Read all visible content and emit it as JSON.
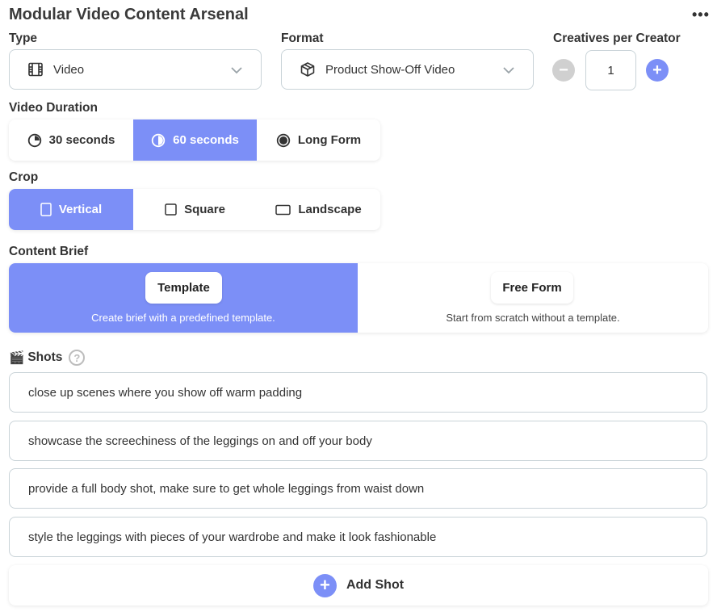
{
  "page": {
    "title": "Modular Video Content Arsenal",
    "more_label": "•••"
  },
  "type": {
    "label": "Type",
    "value": "Video",
    "icon": "film-icon"
  },
  "format": {
    "label": "Format",
    "value": "Product Show-Off Video",
    "icon": "cube-icon"
  },
  "creatives": {
    "label": "Creatives per Creator",
    "value": "1",
    "minus": "−",
    "plus": "+"
  },
  "duration": {
    "label": "Video Duration",
    "options": [
      {
        "label": "30 seconds",
        "icon": "pie-quarter-icon",
        "active": false
      },
      {
        "label": "60 seconds",
        "icon": "pie-half-icon",
        "active": true
      },
      {
        "label": "Long Form",
        "icon": "filled-circle-icon",
        "active": false
      }
    ]
  },
  "crop": {
    "label": "Crop",
    "options": [
      {
        "label": "Vertical",
        "icon": "portrait-rect-icon",
        "active": true
      },
      {
        "label": "Square",
        "icon": "square-icon",
        "active": false
      },
      {
        "label": "Landscape",
        "icon": "landscape-rect-icon",
        "active": false
      }
    ]
  },
  "brief": {
    "label": "Content Brief",
    "options": [
      {
        "label": "Template",
        "desc": "Create brief with a predefined template.",
        "active": true
      },
      {
        "label": "Free Form",
        "desc": "Start from scratch without a template.",
        "active": false
      }
    ]
  },
  "shots": {
    "label": "Shots",
    "emoji": "🎬",
    "help": "?",
    "items": [
      "close up scenes where you show off warm padding",
      "showcase the screechiness of the leggings on and off your body",
      "provide a full body shot, make sure to get whole leggings from waist down",
      "style the leggings with pieces of your wardrobe and make it look fashionable"
    ],
    "add_label": "Add Shot",
    "add_plus": "+"
  },
  "colors": {
    "accent": "#7c8ff7",
    "disabled": "#d0d0d0",
    "border": "#c9d3d8"
  }
}
